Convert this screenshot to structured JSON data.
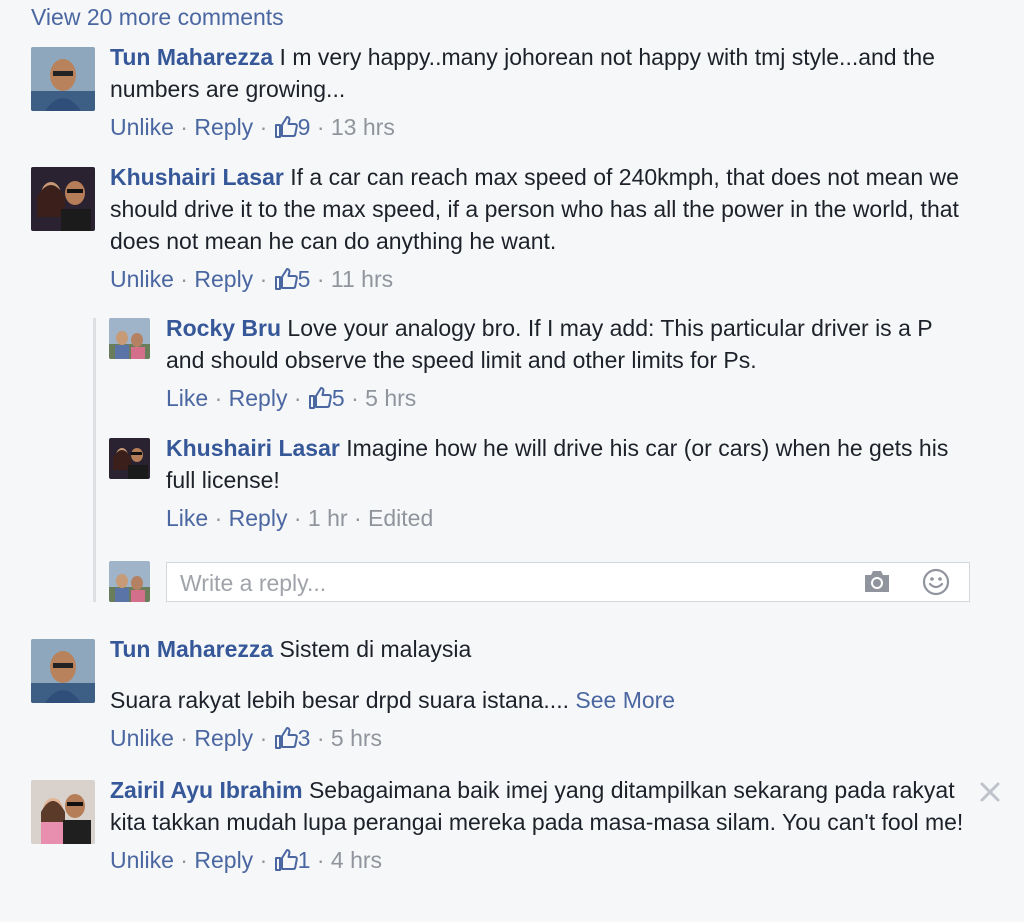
{
  "view_more": "View 20 more comments",
  "comments": [
    {
      "author": "Tun Maharezza",
      "text": " I m very happy..many johorean not happy with tmj style...and the numbers are growing...",
      "like_label": "Unlike",
      "reply_label": "Reply",
      "likes": "9",
      "time": "13 hrs"
    },
    {
      "author": "Khushairi Lasar",
      "text": " If a car can reach max speed of 240kmph, that does not mean we should drive it to the max speed, if a person who has all the power in the world, that does not mean he can do anything he want.",
      "like_label": "Unlike",
      "reply_label": "Reply",
      "likes": "5",
      "time": "11 hrs",
      "replies": [
        {
          "author": "Rocky Bru",
          "text": " Love your analogy bro. If I may add: This particular driver is a P and should observe the speed limit and other limits for Ps.",
          "like_label": "Like",
          "reply_label": "Reply",
          "likes": "5",
          "time": "5 hrs"
        },
        {
          "author": "Khushairi Lasar",
          "text": " Imagine how he will drive his car (or cars) when he gets his full license!",
          "like_label": "Like",
          "reply_label": "Reply",
          "time": "1 hr",
          "edited": "Edited"
        }
      ],
      "reply_placeholder": "Write a reply..."
    },
    {
      "author": "Tun Maharezza",
      "text": " Sistem di malaysia",
      "text2": "Suara rakyat lebih besar drpd suara istana....",
      "see_more": "See More",
      "like_label": "Unlike",
      "reply_label": "Reply",
      "likes": "3",
      "time": "5 hrs"
    },
    {
      "author": "Zairil Ayu Ibrahim",
      "text": " Sebagaimana baik imej yang ditampilkan sekarang pada rakyat kita takkan mudah lupa perangai mereka pada masa-masa silam. You can't fool me!",
      "like_label": "Unlike",
      "reply_label": "Reply",
      "likes": "1",
      "time": "4 hrs"
    }
  ],
  "icons": {
    "thumb": "thumbs-up-icon",
    "camera": "camera-icon",
    "emoji": "smiley-icon",
    "close": "close-icon"
  },
  "colors": {
    "link": "#4b67a1",
    "author": "#365899",
    "meta": "#90949c",
    "background": "#f6f7f9"
  }
}
